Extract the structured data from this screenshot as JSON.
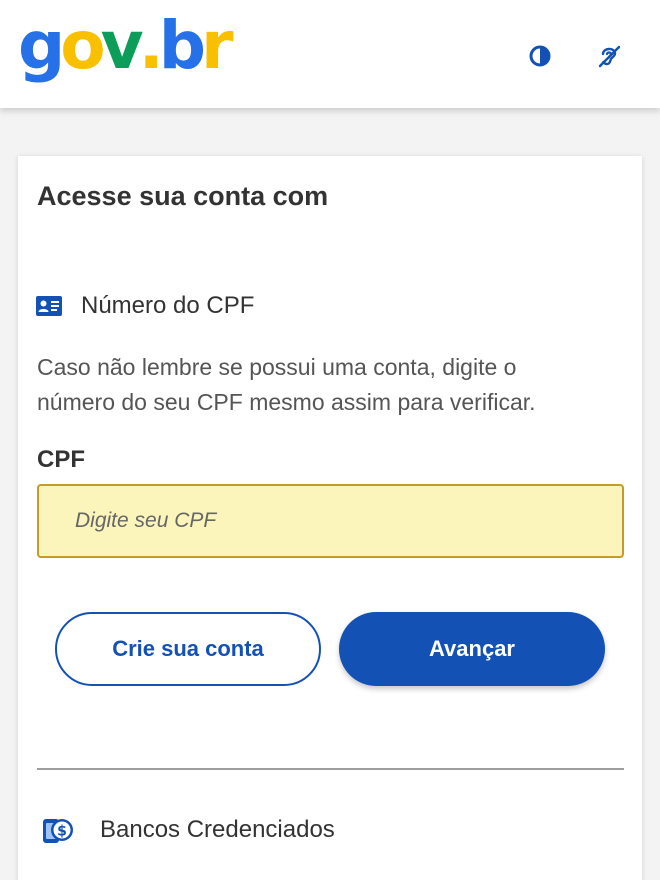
{
  "header": {
    "logo": {
      "g": "g",
      "o": "o",
      "v": "v",
      "dot": ".",
      "b": "b",
      "r": "r"
    },
    "contrast_icon": "contrast-icon",
    "accessibility_icon": "sign-language-icon"
  },
  "login": {
    "title": "Acesse sua conta com",
    "cpf_option_label": "Número do CPF",
    "help_text": "Caso não lembre se possui uma conta, digite o número do seu CPF mesmo assim para verificar.",
    "cpf_field_label": "CPF",
    "cpf_value": "",
    "cpf_placeholder": "Digite seu CPF",
    "create_account_label": "Crie sua conta",
    "next_label": "Avançar",
    "bank_option_label": "Bancos Credenciados"
  },
  "colors": {
    "primary": "#1351b4",
    "logo_g": "#2670e8",
    "logo_o": "#f9c000",
    "logo_v": "#0c9d58",
    "logo_b": "#2670e8",
    "logo_r": "#f9c000",
    "input_bg": "#fbf5bc"
  }
}
